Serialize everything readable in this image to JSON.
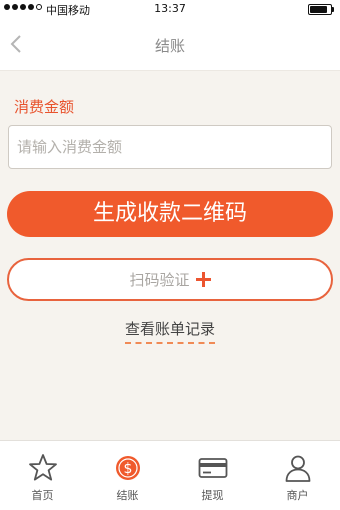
{
  "status_bar": {
    "carrier": "中国移动",
    "time": "13:37"
  },
  "nav": {
    "title": "结账",
    "back_icon": "chevron-left-icon"
  },
  "form": {
    "amount_label": "消费金额",
    "amount_placeholder": "请输入消费金额",
    "amount_value": ""
  },
  "actions": {
    "generate_qr_label": "生成收款二维码",
    "scan_verify_label": "扫码验证",
    "scan_verify_icon": "plus-icon",
    "view_records_label": "查看账单记录"
  },
  "tabs": [
    {
      "label": "首页",
      "icon": "star-icon",
      "active": false
    },
    {
      "label": "结账",
      "icon": "dollar-coin-icon",
      "active": true
    },
    {
      "label": "提现",
      "icon": "card-icon",
      "active": false
    },
    {
      "label": "商户",
      "icon": "user-icon",
      "active": false
    }
  ],
  "colors": {
    "accent": "#f05a2c",
    "label_accent": "#e8532d",
    "background": "#f6f3ee"
  }
}
